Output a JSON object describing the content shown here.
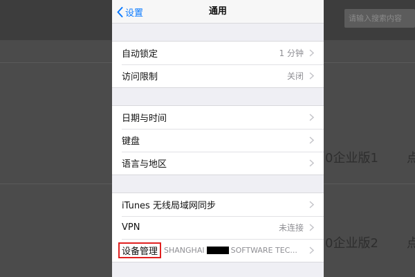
{
  "background": {
    "search_placeholder": "请输入搜索内容",
    "row1_text": "0企业版1",
    "row1_suffix": "点",
    "row2_text": "0企业版2",
    "row2_suffix": "点"
  },
  "nav": {
    "back_label": "设置",
    "title": "通用"
  },
  "groups": [
    {
      "rows": [
        {
          "label": "自动锁定",
          "value": "1 分钟"
        },
        {
          "label": "访问限制",
          "value": "关闭"
        }
      ]
    },
    {
      "rows": [
        {
          "label": "日期与时间",
          "value": ""
        },
        {
          "label": "键盘",
          "value": ""
        },
        {
          "label": "语言与地区",
          "value": ""
        }
      ]
    },
    {
      "rows": [
        {
          "label": "iTunes 无线局域网同步",
          "value": ""
        },
        {
          "label": "VPN",
          "value": "未连接"
        },
        {
          "label": "设备管理",
          "value_prefix": "SHANGHAI",
          "value_suffix": "SOFTWARE TEC..."
        }
      ]
    }
  ],
  "colors": {
    "accent": "#0a7aff",
    "highlight": "#e02020"
  },
  "icons": {
    "back": "chevron-left-icon",
    "disclosure": "chevron-right-icon"
  }
}
